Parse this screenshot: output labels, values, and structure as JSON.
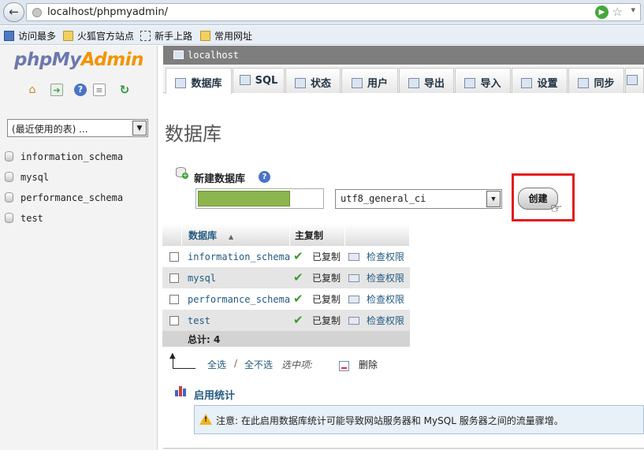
{
  "browser": {
    "url": "localhost/phpmyadmin/",
    "bookmarks": [
      "访问最多",
      "火狐官方站点",
      "新手上路",
      "常用网址"
    ]
  },
  "sidebar": {
    "logo_php": "php",
    "logo_my": "My",
    "logo_admin": "Admin",
    "recent_select": "(最近使用的表) ...",
    "databases": [
      "information_schema",
      "mysql",
      "performance_schema",
      "test"
    ]
  },
  "server_bar": {
    "name": "localhost"
  },
  "tabs": [
    {
      "label": "数据库",
      "icon": "database-icon"
    },
    {
      "label": "SQL",
      "icon": "sql-icon"
    },
    {
      "label": "状态",
      "icon": "status-icon"
    },
    {
      "label": "用户",
      "icon": "users-icon"
    },
    {
      "label": "导出",
      "icon": "export-icon"
    },
    {
      "label": "导入",
      "icon": "import-icon"
    },
    {
      "label": "设置",
      "icon": "settings-icon"
    },
    {
      "label": "同步",
      "icon": "sync-icon"
    }
  ],
  "main": {
    "title": "数据库",
    "new_db_label": "新建数据库",
    "collation": "utf8_general_ci",
    "create_button": "创建",
    "table": {
      "headers": [
        "数据库",
        "主复制"
      ],
      "rows": [
        {
          "name": "information_schema",
          "replication": "已复制",
          "privileges": "检查权限"
        },
        {
          "name": "mysql",
          "replication": "已复制",
          "privileges": "检查权限"
        },
        {
          "name": "performance_schema",
          "replication": "已复制",
          "privileges": "检查权限"
        },
        {
          "name": "test",
          "replication": "已复制",
          "privileges": "检查权限"
        }
      ],
      "total": "总计: 4"
    },
    "select_all": "全选",
    "separator": "/",
    "unselect_all": "全不选",
    "with_selected": "选中项:",
    "drop": "删除",
    "enable_stats": "启用统计",
    "notice": "注意: 在此启用数据库统计可能导致网站服务器和 MySQL 服务器之间的流量骤增。"
  },
  "colors": {
    "accent": "#235a81",
    "highlight": "#e41a1a",
    "logo_blue": "#6c78af",
    "logo_orange": "#f29400"
  }
}
